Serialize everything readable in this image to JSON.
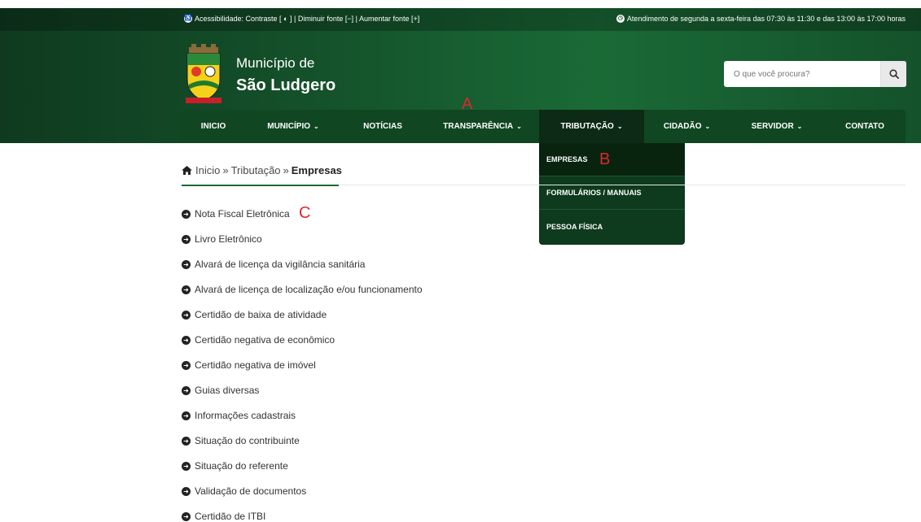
{
  "topbar": {
    "accessibility": "Acessibilidade: Contraste [ ◐ ] | Diminuir fonte [−] | Aumentar fonte [+]",
    "hours": "Atendimento de segunda a sexta-feira das 07:30 às 11:30 e das 13:00 às 17:00 horas"
  },
  "brand": {
    "line1": "Município de",
    "line2": "São Ludgero"
  },
  "search": {
    "placeholder": "O que você procura?"
  },
  "nav": {
    "items": [
      {
        "label": "INICIO",
        "caret": ""
      },
      {
        "label": "MUNICÍPIO",
        "caret": "⌄"
      },
      {
        "label": "NOTÍCIAS",
        "caret": ""
      },
      {
        "label": "TRANSPARÊNCIA",
        "caret": "⌄"
      },
      {
        "label": "TRIBUTAÇÃO",
        "caret": "⌄"
      },
      {
        "label": "CIDADÃO",
        "caret": "⌄"
      },
      {
        "label": "SERVIDOR",
        "caret": "⌄"
      },
      {
        "label": "CONTATO",
        "caret": ""
      }
    ]
  },
  "dropdown": {
    "items": [
      "EMPRESAS",
      "FORMULÁRIOS / MANUAIS",
      "PESSOA FÍSICA"
    ]
  },
  "breadcrumb": {
    "home": "Inicio",
    "sep": "»",
    "section": "Tributação",
    "current": "Empresas"
  },
  "list": {
    "items": [
      "Nota Fiscal Eletrônica",
      "Livro Eletrônico",
      "Alvará de licença da vigilância sanitária",
      "Alvará de licença de localização e/ou funcionamento",
      "Certidão de baixa de atividade",
      "Certidão negativa de econômico",
      "Certidão negativa de imóvel",
      "Guias diversas",
      "Informações cadastrais",
      "Situação do contribuinte",
      "Situação do referente",
      "Validação de documentos",
      "Certidão de ITBI"
    ]
  },
  "markers": {
    "a": "A",
    "b": "B",
    "c": "C"
  },
  "colors": {
    "brand_green": "#14522b",
    "nav_green": "#114622",
    "active_dark": "#0c2a15",
    "marker_red": "#e0262b"
  }
}
